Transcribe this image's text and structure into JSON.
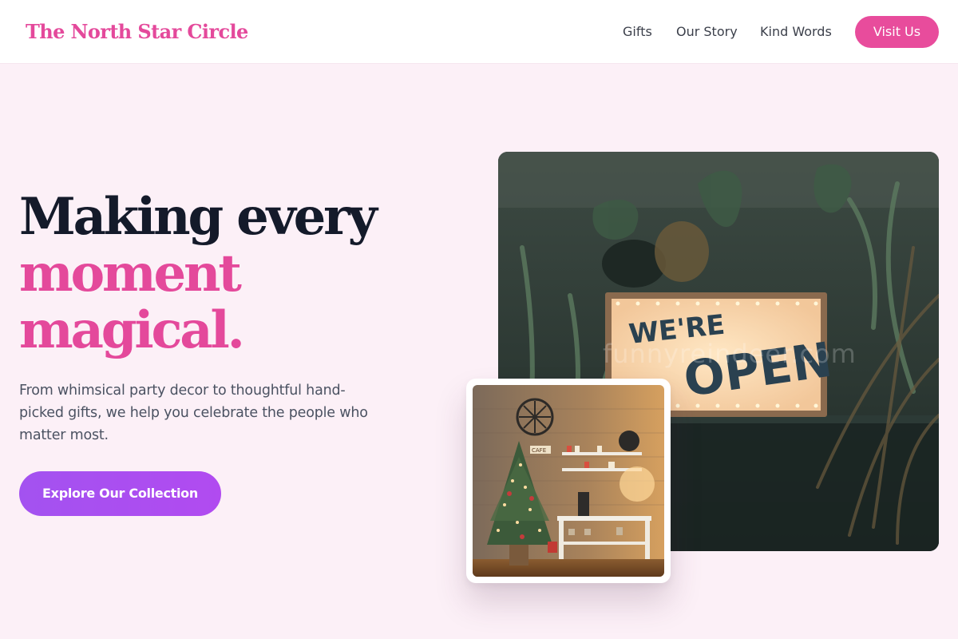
{
  "brand": {
    "name": "The North Star Circle"
  },
  "nav": {
    "items": [
      {
        "label": "Gifts"
      },
      {
        "label": "Our Story"
      },
      {
        "label": "Kind Words"
      }
    ],
    "visit_label": "Visit Us"
  },
  "hero": {
    "title_line1": "Making every",
    "title_line2": "moment",
    "title_line3": "magical.",
    "description": "From whimsical party decor to thoughtful hand-picked gifts, we help you celebrate the people who matter most.",
    "cta_label": "Explore Our Collection"
  },
  "images": {
    "main_sign_text_1": "WE'RE",
    "main_sign_text_2": "OPEN",
    "watermark": "funnyreindeer.com",
    "small_photo_sign": "CAFE"
  },
  "colors": {
    "accent_pink": "#e84c9c",
    "cta_purple": "#a855f7",
    "heading_dark": "#141a2a",
    "page_bg": "#fcf0f7"
  }
}
